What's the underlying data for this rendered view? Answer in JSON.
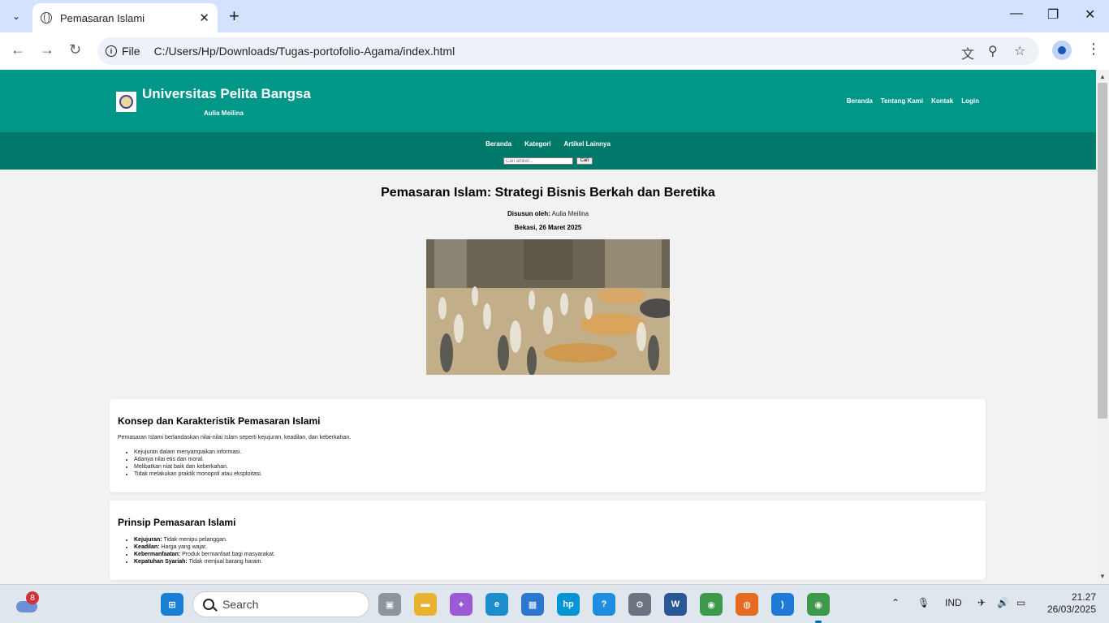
{
  "browser": {
    "tab_title": "Pemasaran Islami",
    "new_tab": "+",
    "url_chip": "File",
    "url": "C:/Users/Hp/Downloads/Tugas-portofolio-Agama/index.html"
  },
  "site": {
    "title": "Universitas Pelita Bangsa",
    "subtitle": "Aulia Meilina",
    "top_nav": [
      "Beranda",
      "Tentang Kami",
      "Kontak",
      "Login"
    ],
    "sub_nav": [
      "Beranda",
      "Kategori",
      "Artikel Lainnya"
    ],
    "search_placeholder": "Cari artikel...",
    "search_button": "Cari"
  },
  "article": {
    "title": "Pemasaran Islam: Strategi Bisnis Berkah dan Beretika",
    "author_label": "Disusun oleh:",
    "author": "Aulia Meilina",
    "date": "Bekasi, 26 Maret 2025"
  },
  "sections": [
    {
      "heading": "Konsep dan Karakteristik Pemasaran Islami",
      "paragraph": "Pemasaran Islami berlandaskan nilai-nilai Islam seperti kejujuran, keadilan, dan keberkahan.",
      "items": [
        "Kejujuran dalam menyampaikan informasi.",
        "Adanya nilai etis dan moral.",
        "Melibatkan niat baik dan keberkahan.",
        "Tidak melakukan praktik monopoli atau eksploitasi."
      ]
    },
    {
      "heading": "Prinsip Pemasaran Islami",
      "items": [
        {
          "term": "Kejujuran:",
          "text": "Tidak menipu pelanggan."
        },
        {
          "term": "Keadilan:",
          "text": "Harga yang wajar."
        },
        {
          "term": "Kebermanfaatan:",
          "text": "Produk bermanfaat bagi masyarakat."
        },
        {
          "term": "Kepatuhan Syariah:",
          "text": "Tidak menjual barang haram."
        }
      ]
    }
  ],
  "taskbar": {
    "weather_badge": "8",
    "search_label": "Search",
    "language": "IND",
    "time": "21.27",
    "date": "26/03/2025"
  },
  "colors": {
    "header": "#009688",
    "subnav": "#00796b",
    "page_bg": "#f2f2f2"
  }
}
